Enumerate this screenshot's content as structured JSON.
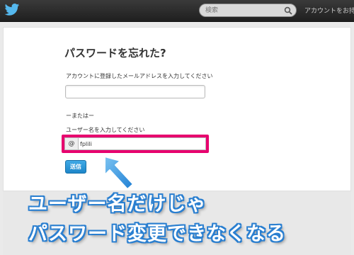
{
  "topbar": {
    "search_placeholder": "検索",
    "account_link": "アカウントをお持ち"
  },
  "form": {
    "title": "パスワードを忘れた?",
    "email_label": "アカウントに登録したメールアドレスを入力してください",
    "email_value": "",
    "or_label": "ーまたはー",
    "username_label": "ユーザー名を入力してください",
    "at_prefix": "@",
    "username_value": "fplili",
    "submit_label": "送信"
  },
  "annotation": {
    "line1": "ユーザー名だけじゃ",
    "line2": "パスワード変更できなくなる",
    "highlight_color": "#e7006e",
    "text_outline_color": "#2a7fd0"
  },
  "colors": {
    "topbar": "#2b2b2b",
    "button": "#2b96d6"
  }
}
